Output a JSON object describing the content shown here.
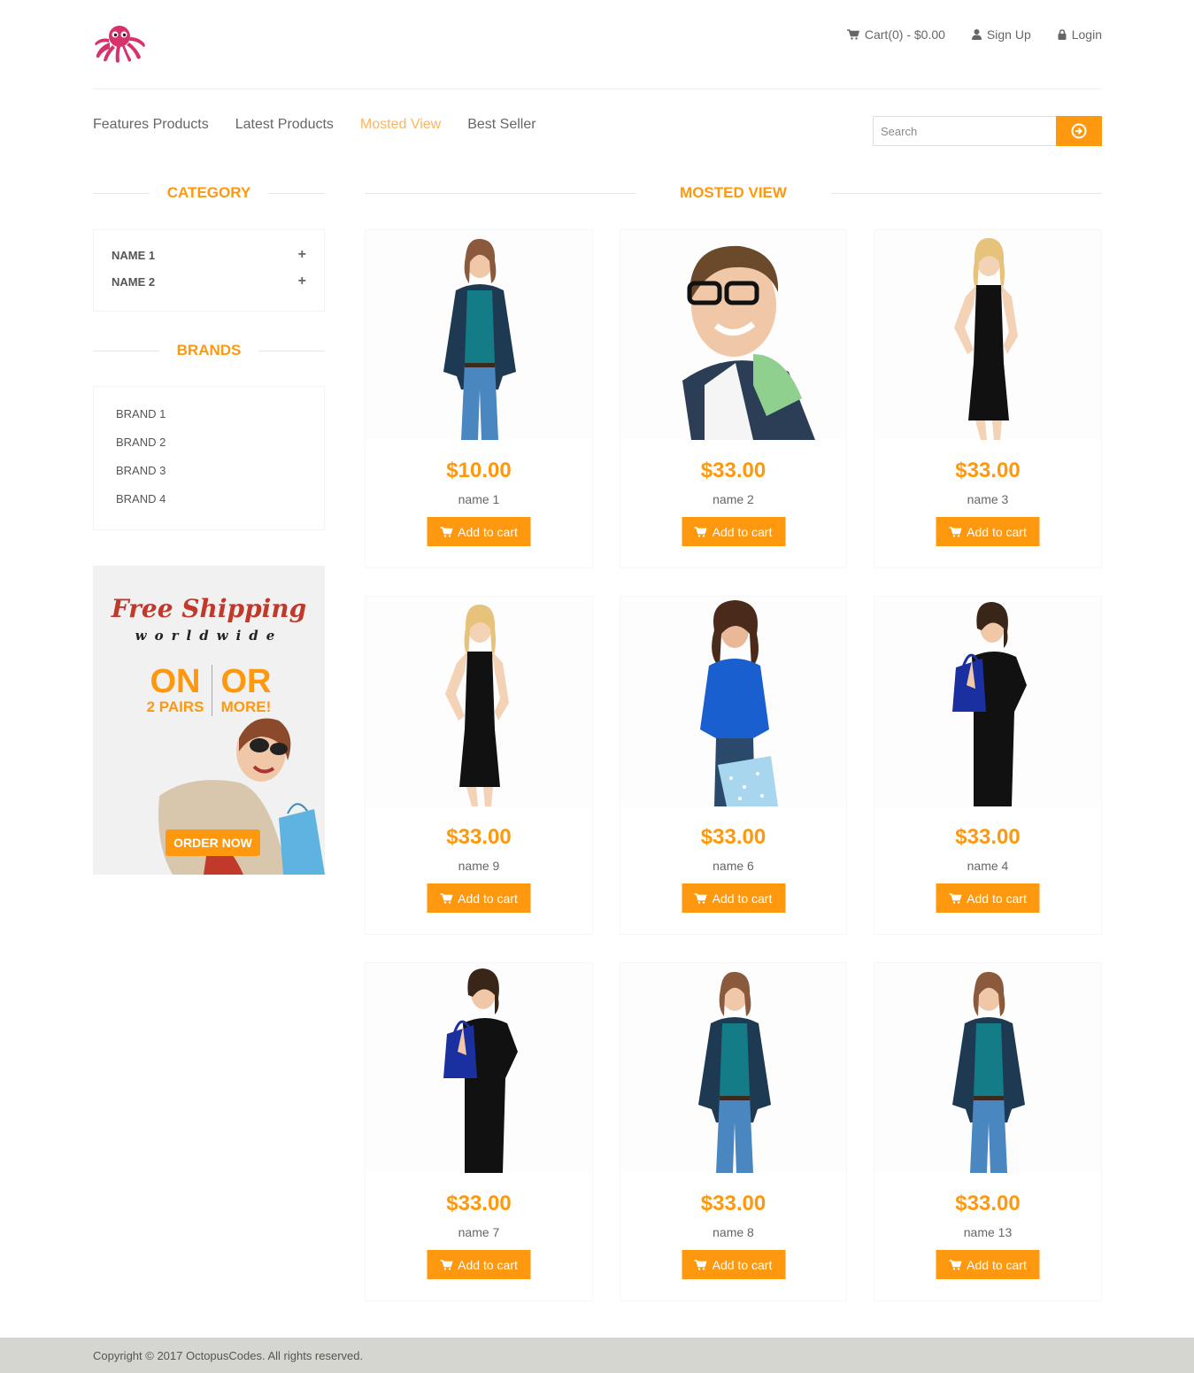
{
  "header": {
    "cart_label": "Cart(0) - $0.00",
    "signup_label": "Sign Up",
    "login_label": "Login"
  },
  "nav": {
    "items": [
      {
        "label": "Features Products",
        "active": false
      },
      {
        "label": "Latest Products",
        "active": false
      },
      {
        "label": "Mosted View",
        "active": true
      },
      {
        "label": "Best Seller",
        "active": false
      }
    ],
    "search_placeholder": "Search"
  },
  "sidebar": {
    "category_title": "Category",
    "categories": [
      "NAME 1",
      "NAME 2"
    ],
    "brands_title": "Brands",
    "brands": [
      "BRAND 1",
      "BRAND 2",
      "BRAND 3",
      "BRAND 4"
    ]
  },
  "ad": {
    "headline": "Free Shipping",
    "subline": "worldwide",
    "left_big": "ON",
    "left_small": "2 PAIRS",
    "right_big": "OR",
    "right_small": "MORE!",
    "button": "ORDER NOW"
  },
  "main": {
    "title": "Mosted View",
    "add_label": "Add to cart",
    "products": [
      {
        "price": "$10.00",
        "name": "name 1",
        "figure": "woman-cardigan"
      },
      {
        "price": "$33.00",
        "name": "name 2",
        "figure": "man-glasses"
      },
      {
        "price": "$33.00",
        "name": "name 3",
        "figure": "woman-dress"
      },
      {
        "price": "$33.00",
        "name": "name 9",
        "figure": "woman-dress"
      },
      {
        "price": "$33.00",
        "name": "name 6",
        "figure": "woman-blue-shopping"
      },
      {
        "price": "$33.00",
        "name": "name 4",
        "figure": "woman-black-bag"
      },
      {
        "price": "$33.00",
        "name": "name 7",
        "figure": "woman-black-bag"
      },
      {
        "price": "$33.00",
        "name": "name 8",
        "figure": "woman-cardigan"
      },
      {
        "price": "$33.00",
        "name": "name 13",
        "figure": "woman-cardigan"
      }
    ]
  },
  "footer": {
    "copyright": "Copyright © 2017 OctopusCodes. All rights reserved."
  },
  "colors": {
    "accent": "#fe980f",
    "active_nav": "#fdb45e",
    "footer_bg": "#d6d6d0",
    "logo": "#d6336c"
  }
}
